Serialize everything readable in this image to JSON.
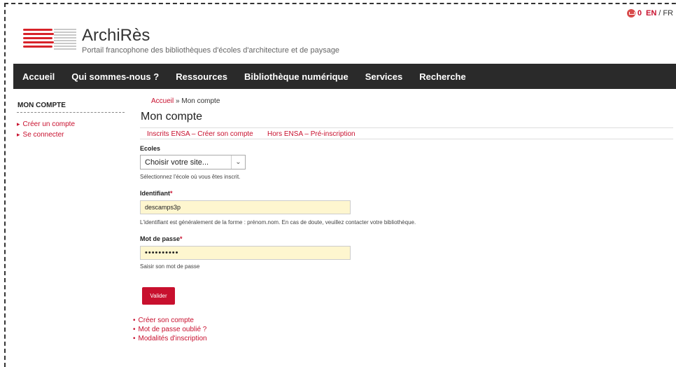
{
  "topbar": {
    "cart_count": "0",
    "lang_en": "EN",
    "lang_sep": "/",
    "lang_fr": "FR"
  },
  "logo": {
    "title": "ArchiRès",
    "subtitle": "Portail francophone des bibliothèques d'écoles d'architecture et de paysage"
  },
  "nav": [
    "Accueil",
    "Qui sommes-nous ?",
    "Ressources",
    "Bibliothèque numérique",
    "Services",
    "Recherche"
  ],
  "sidebar": {
    "title": "MON COMPTE",
    "items": [
      "Créer un compte",
      "Se connecter"
    ]
  },
  "breadcrumb": {
    "home": "Accueil",
    "sep": "»",
    "current": "Mon compte"
  },
  "page": {
    "title": "Mon compte",
    "tabs": [
      "Inscrits ENSA – Créer son compte",
      "Hors ENSA – Pré-inscription"
    ]
  },
  "form": {
    "ecoles_label": "Ecoles",
    "ecoles_value": "Choisir votre site...",
    "ecoles_help": "Sélectionnez l'école où vous êtes inscrit.",
    "id_label": "Identifiant",
    "id_value": "descamps3p",
    "id_help": "L'identifiant est généralement de la forme : prénom.nom. En cas de doute, veuillez contacter votre bibliothèque.",
    "pwd_label": "Mot de passe",
    "pwd_value": "••••••••••",
    "pwd_help": "Saisir son mot de passe",
    "required_mark": "*",
    "submit": "Valider"
  },
  "links": [
    "Créer son compte",
    "Mot de passe oublié ?",
    "Modalités d'inscription"
  ],
  "colors": {
    "accent": "#c8102e",
    "nav_bg": "#2a2a2a",
    "input_bg": "#fef6cf"
  }
}
